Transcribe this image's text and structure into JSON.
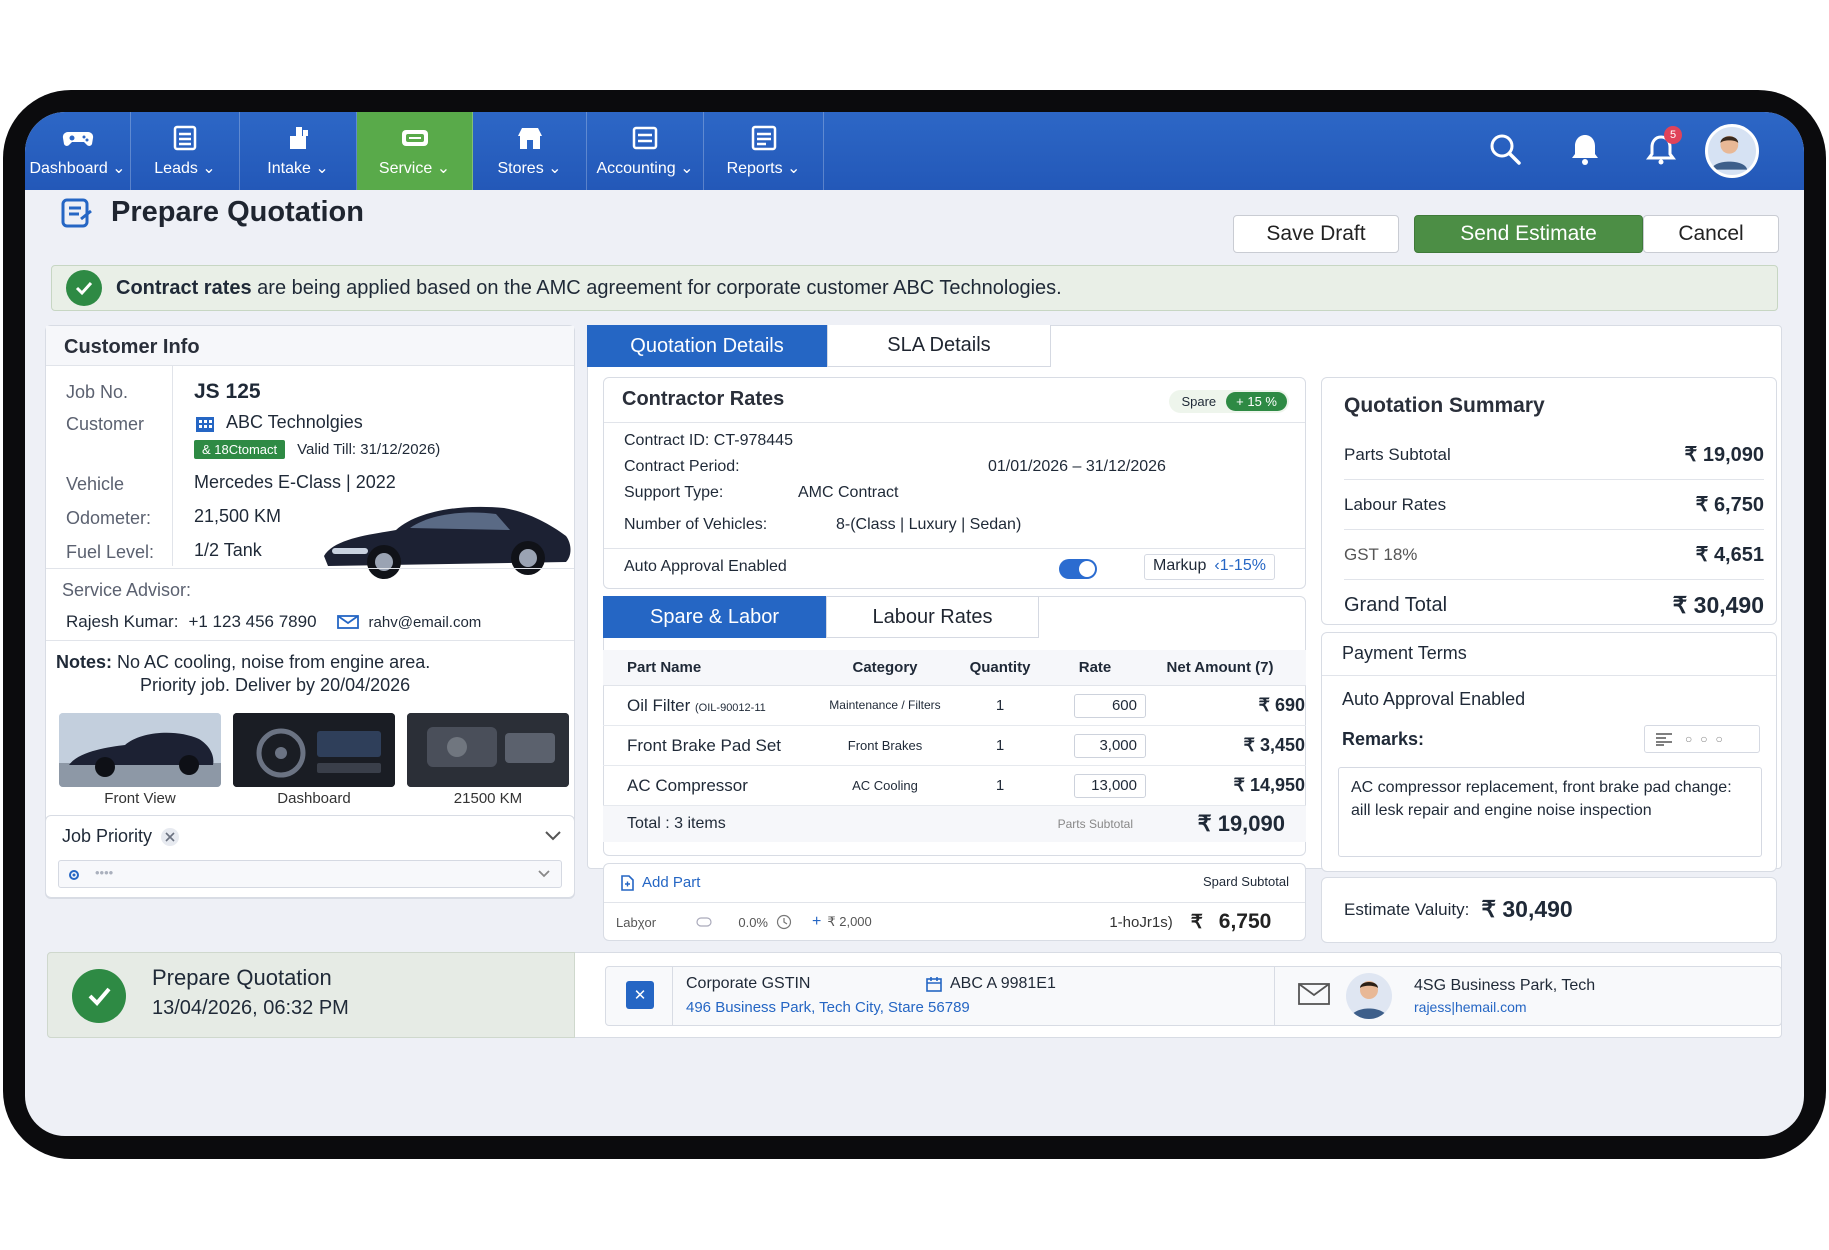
{
  "nav": {
    "items": [
      {
        "label": "Dashboard ⌄",
        "icon": "gamepad-icon"
      },
      {
        "label": "Leads ⌄",
        "icon": "list-icon"
      },
      {
        "label": "Intake ⌄",
        "icon": "intake-icon"
      },
      {
        "label": "Service ⌄",
        "icon": "service-icon"
      },
      {
        "label": "Stores ⌄",
        "icon": "store-icon"
      },
      {
        "label": "Accounting ⌄",
        "icon": "accounting-icon"
      },
      {
        "label": "Reports ⌄",
        "icon": "reports-icon"
      }
    ],
    "active": "Service",
    "notif_count": "5"
  },
  "header": {
    "title": "Prepare Quotation",
    "save_draft": "Save Draft",
    "send_estimate": "Send Estimate",
    "cancel": "Cancel"
  },
  "banner": {
    "bold": "Contract rates",
    "text": " are being applied based on the AMC agreement for corporate customer ABC Technologies."
  },
  "customer": {
    "title": "Customer Info",
    "job_label": "Job No.",
    "job_value": "JS 125",
    "customer_label": "Customer",
    "customer_value": "ABC Technolgies",
    "tag": "& 18Ctomact",
    "valid": "Valid Till: 31/12/2026)",
    "vehicle_label": "Vehicle",
    "vehicle_value": "Mercedes E-Class  |  2022",
    "odometer_label": "Odometer:",
    "odometer_value": "21,500 KM",
    "fuel_label": "Fuel Level:",
    "fuel_value": "1/2 Tank",
    "advisor_label": "Service Advisor:",
    "advisor_name": "Rajesh Kumar:",
    "advisor_phone": "+1 123 456 7890",
    "advisor_email": "rahv@email.com",
    "notes_label": "Notes:",
    "notes_line1": "No AC cooling, noise from engine area.",
    "notes_line2": "Priority job. Deliver by 20/04/2026",
    "photos": [
      "Front View",
      "Dashboard",
      "21500 KM"
    ],
    "priority_label": "Job Priority",
    "priority_placeholder": "••••"
  },
  "tabs": {
    "quotation": "Quotation Details",
    "sla": "SLA Details"
  },
  "contractor": {
    "title": "Contractor Rates",
    "pill_label": "Spare",
    "pill_value": "+ 15 %",
    "contract_id": "Contract ID: CT-978445",
    "period_label": "Contract Period:",
    "period_value": "01/01/2026 – 31/12/2026",
    "support_label": "Support Type:",
    "support_value": "AMC Contract",
    "vehicles_label": "Number of Vehicles:",
    "vehicles_value": "8-(Class  |  Luxury   |  Sedan)",
    "auto_label": "Auto Approval Enabled",
    "markup_label": "Markup",
    "markup_value": "‹1-15%"
  },
  "subtabs": {
    "spare": "Spare & Labor",
    "labour": "Labour Rates"
  },
  "parts": {
    "headers": [
      "Part Name",
      "Category",
      "Quantity",
      "Rate",
      "Net Amount (7)"
    ],
    "rows": [
      {
        "name": "Oil Filter",
        "code": "(OIL-90012-11",
        "category": "Maintenance / Filters",
        "qty": "1",
        "rate": "600",
        "amount": "₹ 690"
      },
      {
        "name": "Front Brake Pad Set",
        "code": "",
        "category": "Front Brakes",
        "qty": "1",
        "rate": "3,000",
        "amount": "₹ 3,450"
      },
      {
        "name": "AC Compressor",
        "code": "",
        "category": "AC Cooling",
        "qty": "1",
        "rate": "13,000",
        "amount": "₹ 14,950"
      }
    ],
    "total_label": "Total : 3 items",
    "subtotal_label": "Parts Subtotal",
    "subtotal_value": "₹ 19,090"
  },
  "addpart": {
    "label": "Add Part",
    "spare_subtotal": "Spard Subtotal",
    "labor_label": "Labχor",
    "labor_pct": "0.0%",
    "labor_rate": "₹ 2,000",
    "labor_hours": "1-hoJr1s)",
    "labor_currency": "₹",
    "labor_total": "6,750"
  },
  "summary": {
    "title": "Quotation Summary",
    "rows": [
      {
        "label": "Parts Subtotal",
        "value": "₹ 19,090"
      },
      {
        "label": "Labour Rates",
        "value": "₹ 6,750"
      },
      {
        "label": "GST 18%",
        "value": "₹ 4,651"
      }
    ],
    "grand_label": "Grand Total",
    "grand_value": "₹ 30,490"
  },
  "payment": {
    "title": "Payment Terms",
    "auto": "Auto Approval Enabled",
    "remarks_label": "Remarks:",
    "remarks_text": "AC compressor replacement, front brake pad change: aill lesk repair and engine noise inspection"
  },
  "estimate": {
    "label": "Estimate Valuity:",
    "value": "₹ 30,490"
  },
  "footer": {
    "status_title": "Prepare Quotation",
    "status_time": "13/04/2026, 06:32 PM",
    "gstin_label": "Corporate GSTIN",
    "gstin_value": "ABC A 9981E1",
    "address": "496 Business Park, Tech City, Stare 56789",
    "contact_address": "4SG Business Park, Tech",
    "contact_email": "rajess|hemail.com"
  }
}
